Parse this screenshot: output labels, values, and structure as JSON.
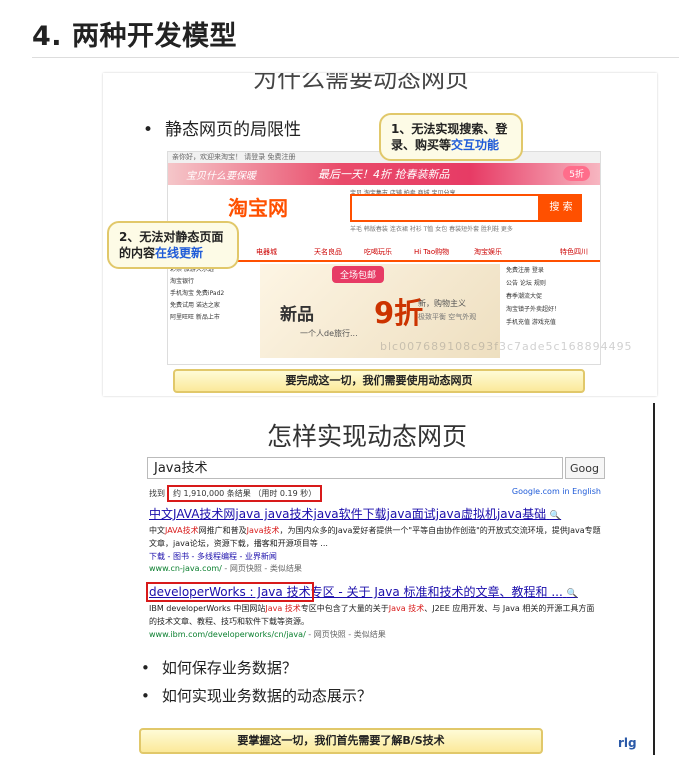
{
  "heading": "4. 两种开发模型",
  "slide1": {
    "title_partial": "为什么需要动态网页",
    "bullet": "静态网页的局限性",
    "screenshot": {
      "topbar": "亲你好，欢迎来淘宝！ 请登录  免费注册",
      "banner_left": "宝贝什么要保暖",
      "banner_center": "最后一天！4折 抢春装新品",
      "banner_right": "5折",
      "logo": "淘宝网",
      "search_tabs": "宝贝  淘宝集市  店铺  拍卖  商城  宝贝分享",
      "search_button": "搜 索",
      "hot_words": "羊毛  韩版春装  连衣裙  衬衫  T恤  女包  春装短外套  胜利鞋  更多",
      "nav": [
        "电器城",
        "天名良品",
        "吃喝玩乐",
        "Hi Tao购物",
        "淘宝娱乐",
        "特色四川"
      ],
      "side_items": [
        "彩票   旅游大乐透",
        "淘宝银行",
        "手机淘宝  免费iPad2",
        "免费试用  诺达之家",
        "阿里旺旺  新品上市"
      ],
      "promo_tag": "全场包邮",
      "promo_main": "新品",
      "promo_discount": "9折",
      "promo_sub": "一个人de旅行...",
      "promo_right1": "新，购物主义",
      "promo_right2": "极致平衡 空气外观",
      "right_items": [
        "免费注册  登录",
        "公告  论坛  规则",
        "春季潮流大促",
        "淘宝镇子外卖超好！",
        "手机充值  游戏充值"
      ],
      "watermark": "blc007689108c93f3c7ade5c168894495"
    },
    "callout1_text": "1、无法实现搜索、登录、购买等",
    "callout1_highlight": "交互功能",
    "callout2_text": "2、无法对静态页面的内容",
    "callout2_highlight": "在线更新",
    "banner": "要完成这一切，我们需要使用动态网页"
  },
  "slide2": {
    "title": "怎样实现动态网页",
    "search": {
      "query": "Java技术",
      "button": "Goog",
      "stats_prefix": "找到",
      "stats_boxed": "约 1,910,000 条结果 （用时 0.19 秒）",
      "site_link": "Google.com in English"
    },
    "results": [
      {
        "title": "中文JAVA技术网java java技术java软件下载java面试java虚拟机java基础",
        "body_1": "中文",
        "body_kw1": "JAVA技术",
        "body_2": "网推广和普及",
        "body_kw2": "Java技术",
        "body_3": "，为国内众多的Java爱好者提供一个\"平等自由协作创造\"的开放式交流环境，提供Java专题文章，java论坛，资源下载，播客和开源项目等 ...",
        "links": "下载 - 图书 - 多线程编程 - 业界新闻",
        "url": "www.cn-java.com/",
        "url_extra": " - 网页快照 - 类似结果"
      },
      {
        "title_boxed": "developerWorks : Java 技术",
        "title_rest": "专区 - 关于 Java 标准和技术的文章、教程和 ...",
        "body_1": "IBM developerWorks 中国网站",
        "body_kw1": "Java 技术",
        "body_2": "专区中包含了大量的关于",
        "body_kw2": "Java 技术",
        "body_3": "、J2EE 应用开发、与 Java 相关的开源工具方面的技术文章、教程、技巧和软件下载等资源。",
        "url": "www.ibm.com/developerworks/cn/java/",
        "url_extra": " - 网页快照 - 类似结果"
      }
    ],
    "bullets": [
      "如何保存业务数据？",
      "如何实现业务数据的动态展示？"
    ],
    "banner": "要掌握这一切，我们首先需要了解B/S技术"
  },
  "corner_mark": "rlg"
}
